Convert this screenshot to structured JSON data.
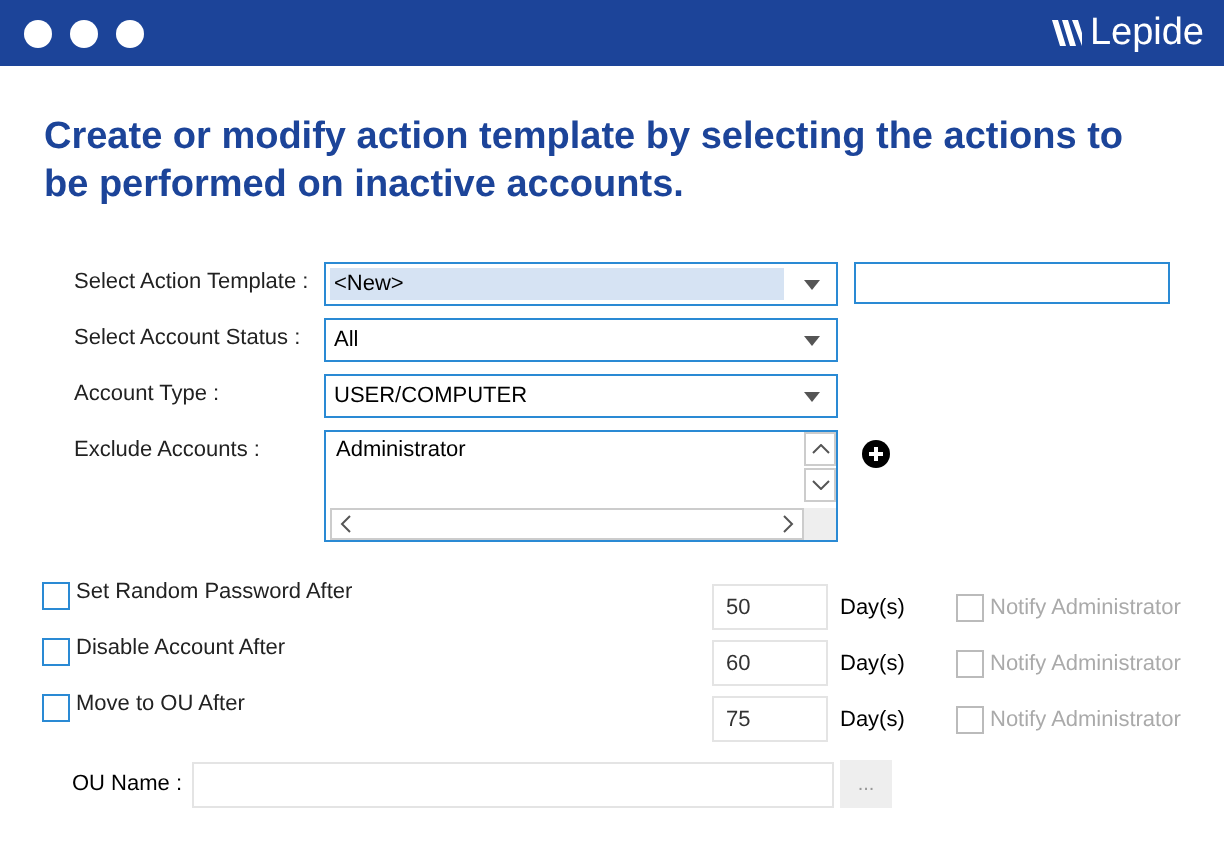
{
  "window": {
    "brand": "Lepide"
  },
  "heading": "Create or modify action template by selecting the actions to be performed on inactive accounts.",
  "form": [
    {
      "kind": "combo",
      "label": "Select Action Template :",
      "value": "<New>",
      "highlighted": true,
      "extra_field": true
    },
    {
      "kind": "combo",
      "label": "Select Account Status :",
      "value": "All",
      "highlighted": false,
      "extra_field": false
    },
    {
      "kind": "combo",
      "label": "Account Type :",
      "value": "USER/COMPUTER",
      "highlighted": false,
      "extra_field": false
    },
    {
      "kind": "list",
      "label": "Exclude Accounts :",
      "items": [
        "Administrator"
      ]
    }
  ],
  "actions": [
    {
      "label": "Set Random Password After",
      "checked": false,
      "days": "50",
      "unit": "Day(s)",
      "notify": {
        "label": "Notify Administrator",
        "checked": false,
        "disabled": true
      }
    },
    {
      "label": "Disable Account After",
      "checked": false,
      "days": "60",
      "unit": "Day(s)",
      "notify": {
        "label": "Notify Administrator",
        "checked": false,
        "disabled": true
      }
    },
    {
      "label": "Move to OU After",
      "checked": false,
      "days": "75",
      "unit": "Day(s)",
      "notify": {
        "label": "Notify Administrator",
        "checked": false,
        "disabled": true
      }
    }
  ],
  "ou": {
    "label": "OU Name :",
    "browse": "..."
  }
}
